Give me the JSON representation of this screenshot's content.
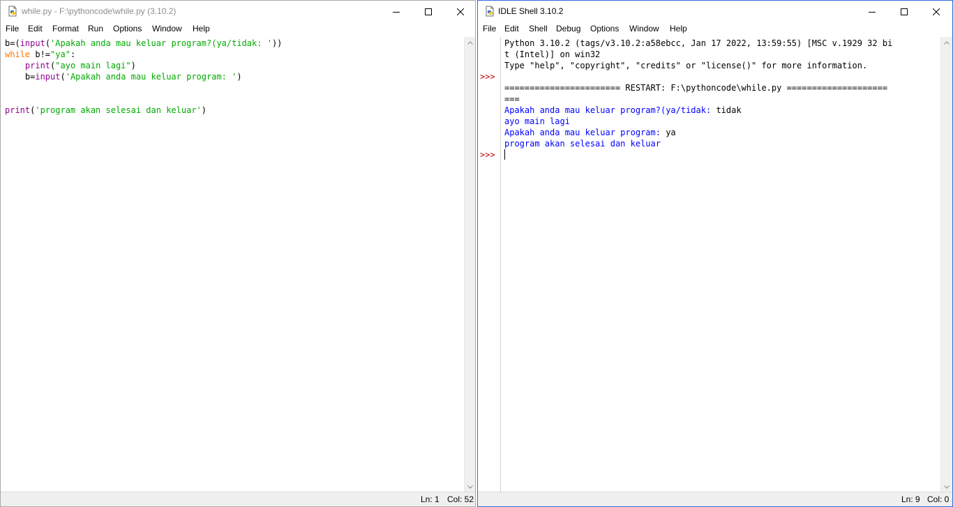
{
  "editor": {
    "title": "while.py - F:\\pythoncode\\while.py (3.10.2)",
    "menu": [
      "File",
      "Edit",
      "Format",
      "Run",
      "Options",
      "Window",
      "Help"
    ],
    "code": [
      [
        {
          "t": "b=(",
          "c": "plain"
        },
        {
          "t": "input",
          "c": "bi"
        },
        {
          "t": "(",
          "c": "plain"
        },
        {
          "t": "'Apakah anda mau keluar program?(ya/tidak: '",
          "c": "str"
        },
        {
          "t": "))",
          "c": "plain"
        }
      ],
      [
        {
          "t": "while",
          "c": "kw"
        },
        {
          "t": " b!=",
          "c": "plain"
        },
        {
          "t": "\"ya\"",
          "c": "str"
        },
        {
          "t": ":",
          "c": "plain"
        }
      ],
      [
        {
          "t": "    ",
          "c": "plain"
        },
        {
          "t": "print",
          "c": "bi"
        },
        {
          "t": "(",
          "c": "plain"
        },
        {
          "t": "\"ayo main lagi\"",
          "c": "str"
        },
        {
          "t": ")",
          "c": "plain"
        }
      ],
      [
        {
          "t": "    b=",
          "c": "plain"
        },
        {
          "t": "input",
          "c": "bi"
        },
        {
          "t": "(",
          "c": "plain"
        },
        {
          "t": "'Apakah anda mau keluar program: '",
          "c": "str"
        },
        {
          "t": ")",
          "c": "plain"
        }
      ],
      [],
      [],
      [
        {
          "t": "print",
          "c": "bi"
        },
        {
          "t": "(",
          "c": "plain"
        },
        {
          "t": "'program akan selesai dan keluar'",
          "c": "str"
        },
        {
          "t": ")",
          "c": "plain"
        }
      ]
    ],
    "status": {
      "ln": "Ln: 1",
      "col": "Col: 52"
    }
  },
  "shell": {
    "title": "IDLE Shell 3.10.2",
    "menu": [
      "File",
      "Edit",
      "Shell",
      "Debug",
      "Options",
      "Window",
      "Help"
    ],
    "prompt_symbol": ">>>",
    "lines": [
      {
        "gutter": "",
        "parts": [
          {
            "t": "Python 3.10.2 (tags/v3.10.2:a58ebcc, Jan 17 2022, 13:59:55) [MSC v.1929 32 bi",
            "c": "plain"
          }
        ]
      },
      {
        "gutter": "",
        "parts": [
          {
            "t": "t (Intel)] on win32",
            "c": "plain"
          }
        ]
      },
      {
        "gutter": "",
        "parts": [
          {
            "t": "Type \"help\", \"copyright\", \"credits\" or \"license()\" for more information.",
            "c": "plain"
          }
        ]
      },
      {
        "gutter": ">>>",
        "parts": []
      },
      {
        "gutter": "",
        "parts": [
          {
            "t": "======================= RESTART: F:\\pythoncode\\while.py ====================",
            "c": "plain"
          }
        ]
      },
      {
        "gutter": "",
        "parts": [
          {
            "t": "===",
            "c": "plain"
          }
        ]
      },
      {
        "gutter": "",
        "parts": [
          {
            "t": "Apakah anda mau keluar program?(ya/tidak: ",
            "c": "out"
          },
          {
            "t": "tidak",
            "c": "plain"
          }
        ]
      },
      {
        "gutter": "",
        "parts": [
          {
            "t": "ayo main lagi",
            "c": "out"
          }
        ]
      },
      {
        "gutter": "",
        "parts": [
          {
            "t": "Apakah anda mau keluar program: ",
            "c": "out"
          },
          {
            "t": "ya",
            "c": "plain"
          }
        ]
      },
      {
        "gutter": "",
        "parts": [
          {
            "t": "program akan selesai dan keluar",
            "c": "out"
          }
        ]
      },
      {
        "gutter": ">>>",
        "parts": []
      }
    ],
    "status": {
      "ln": "Ln: 9",
      "col": "Col: 0"
    }
  },
  "colors": {
    "keyword": "#ff7700",
    "builtin": "#900090",
    "string": "#00aa00",
    "output": "#0000ff",
    "prompt": "#c00000"
  },
  "icons": [
    "python-file-icon",
    "minimize-icon",
    "maximize-icon",
    "close-icon",
    "scroll-up-arrow-icon",
    "scroll-down-arrow-icon"
  ]
}
